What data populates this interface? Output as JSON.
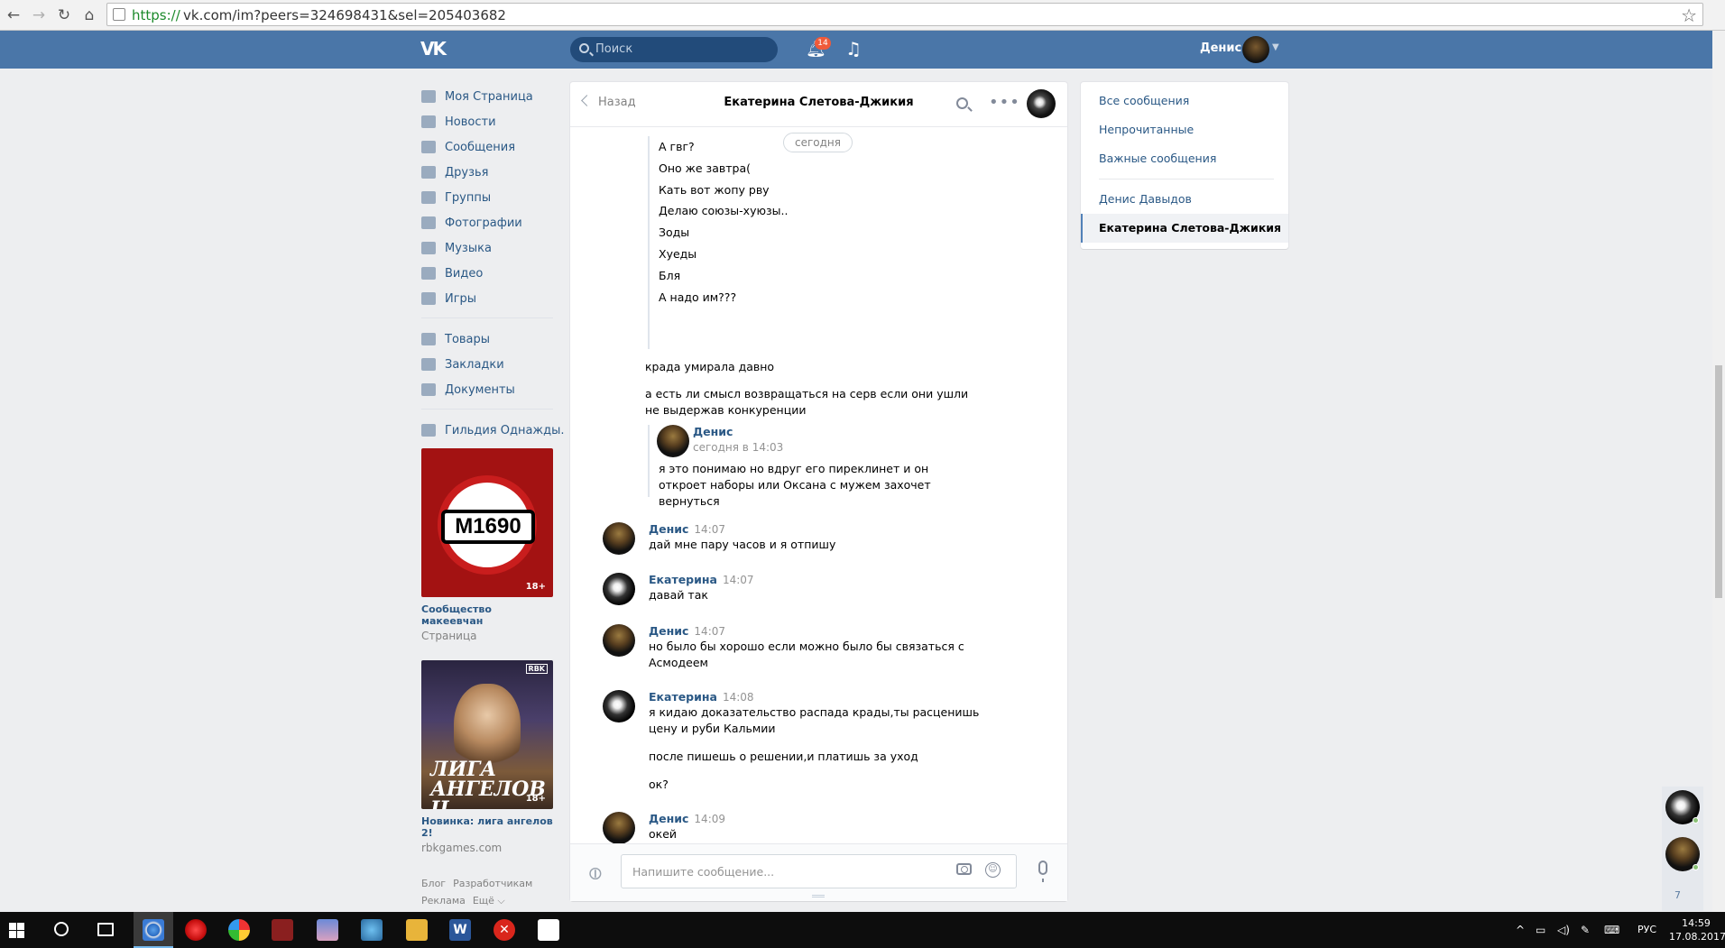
{
  "browser": {
    "url_proto": "https://",
    "url_rest": "vk.com/im?peers=324698431&sel=205403682"
  },
  "header": {
    "search_placeholder": "Поиск",
    "notif_count": "14",
    "user_name": "Денис"
  },
  "left_menu": {
    "items": [
      "Моя Страница",
      "Новости",
      "Сообщения",
      "Друзья",
      "Группы",
      "Фотографии",
      "Музыка",
      "Видео",
      "Игры"
    ],
    "items2": [
      "Товары",
      "Закладки",
      "Документы"
    ],
    "items3": [
      "Гильдия Однажды."
    ]
  },
  "ads": [
    {
      "plate": "M1690",
      "age": "18+",
      "title": "Сообщество макеевчан",
      "sub": "Страница"
    },
    {
      "logo": "ЛИГА АНГЕЛОВ II",
      "badge": "RBK",
      "age": "18+",
      "title": "Новинка: лига ангелов 2!",
      "sub": "rbkgames.com"
    }
  ],
  "footer": {
    "links": [
      "Блог",
      "Разработчикам",
      "Реклама",
      "Ещё ⌵"
    ]
  },
  "chat": {
    "back": "Назад",
    "title": "Екатерина Слетова-Джикия",
    "date_pill": "сегодня",
    "forwarded_lines": [
      "А гвг?",
      "Оно же завтра(",
      "Кать вот жопу рву",
      "Делаю союзы-хуюзы..",
      "Зоды",
      "Хуеды",
      "Бля",
      "А надо им???"
    ],
    "plain1": "крада умирала давно",
    "plain2": "а есть ли смысл возвращаться на серв если они ушли не выдержав конкуренции",
    "fwd": {
      "name": "Денис",
      "time": "сегодня в 14:03",
      "text": "я это понимаю но вдруг его пиреклинет и он откроет наборы или Оксана с мужем захочет вернуться"
    },
    "messages": [
      {
        "name": "Денис",
        "time": "14:07",
        "lines": [
          "дай мне пару часов и я отпишу"
        ]
      },
      {
        "name": "Екатерина",
        "time": "14:07",
        "lines": [
          "давай так"
        ]
      },
      {
        "name": "Денис",
        "time": "14:07",
        "lines": [
          "но было бы хорошо если можно было бы связаться с Асмодеем"
        ]
      },
      {
        "name": "Екатерина",
        "time": "14:08",
        "lines": [
          "я кидаю доказательство распада крады,ты расценишь цену и руби Кальмии",
          "после пишешь о решении,и платишь за уход",
          "ок?"
        ]
      },
      {
        "name": "Денис",
        "time": "14:09",
        "lines": [
          "окей"
        ]
      }
    ],
    "input_placeholder": "Напишите сообщение..."
  },
  "right_nav": {
    "items": [
      "Все сообщения",
      "Непрочитанные",
      "Важные сообщения"
    ],
    "dialogs": [
      "Денис Давыдов"
    ],
    "active": "Екатерина Слетова-Джикия"
  },
  "fast_chat": {
    "count": "7"
  },
  "taskbar": {
    "lang": "РУС",
    "time": "14:59",
    "date": "17.08.2017"
  }
}
